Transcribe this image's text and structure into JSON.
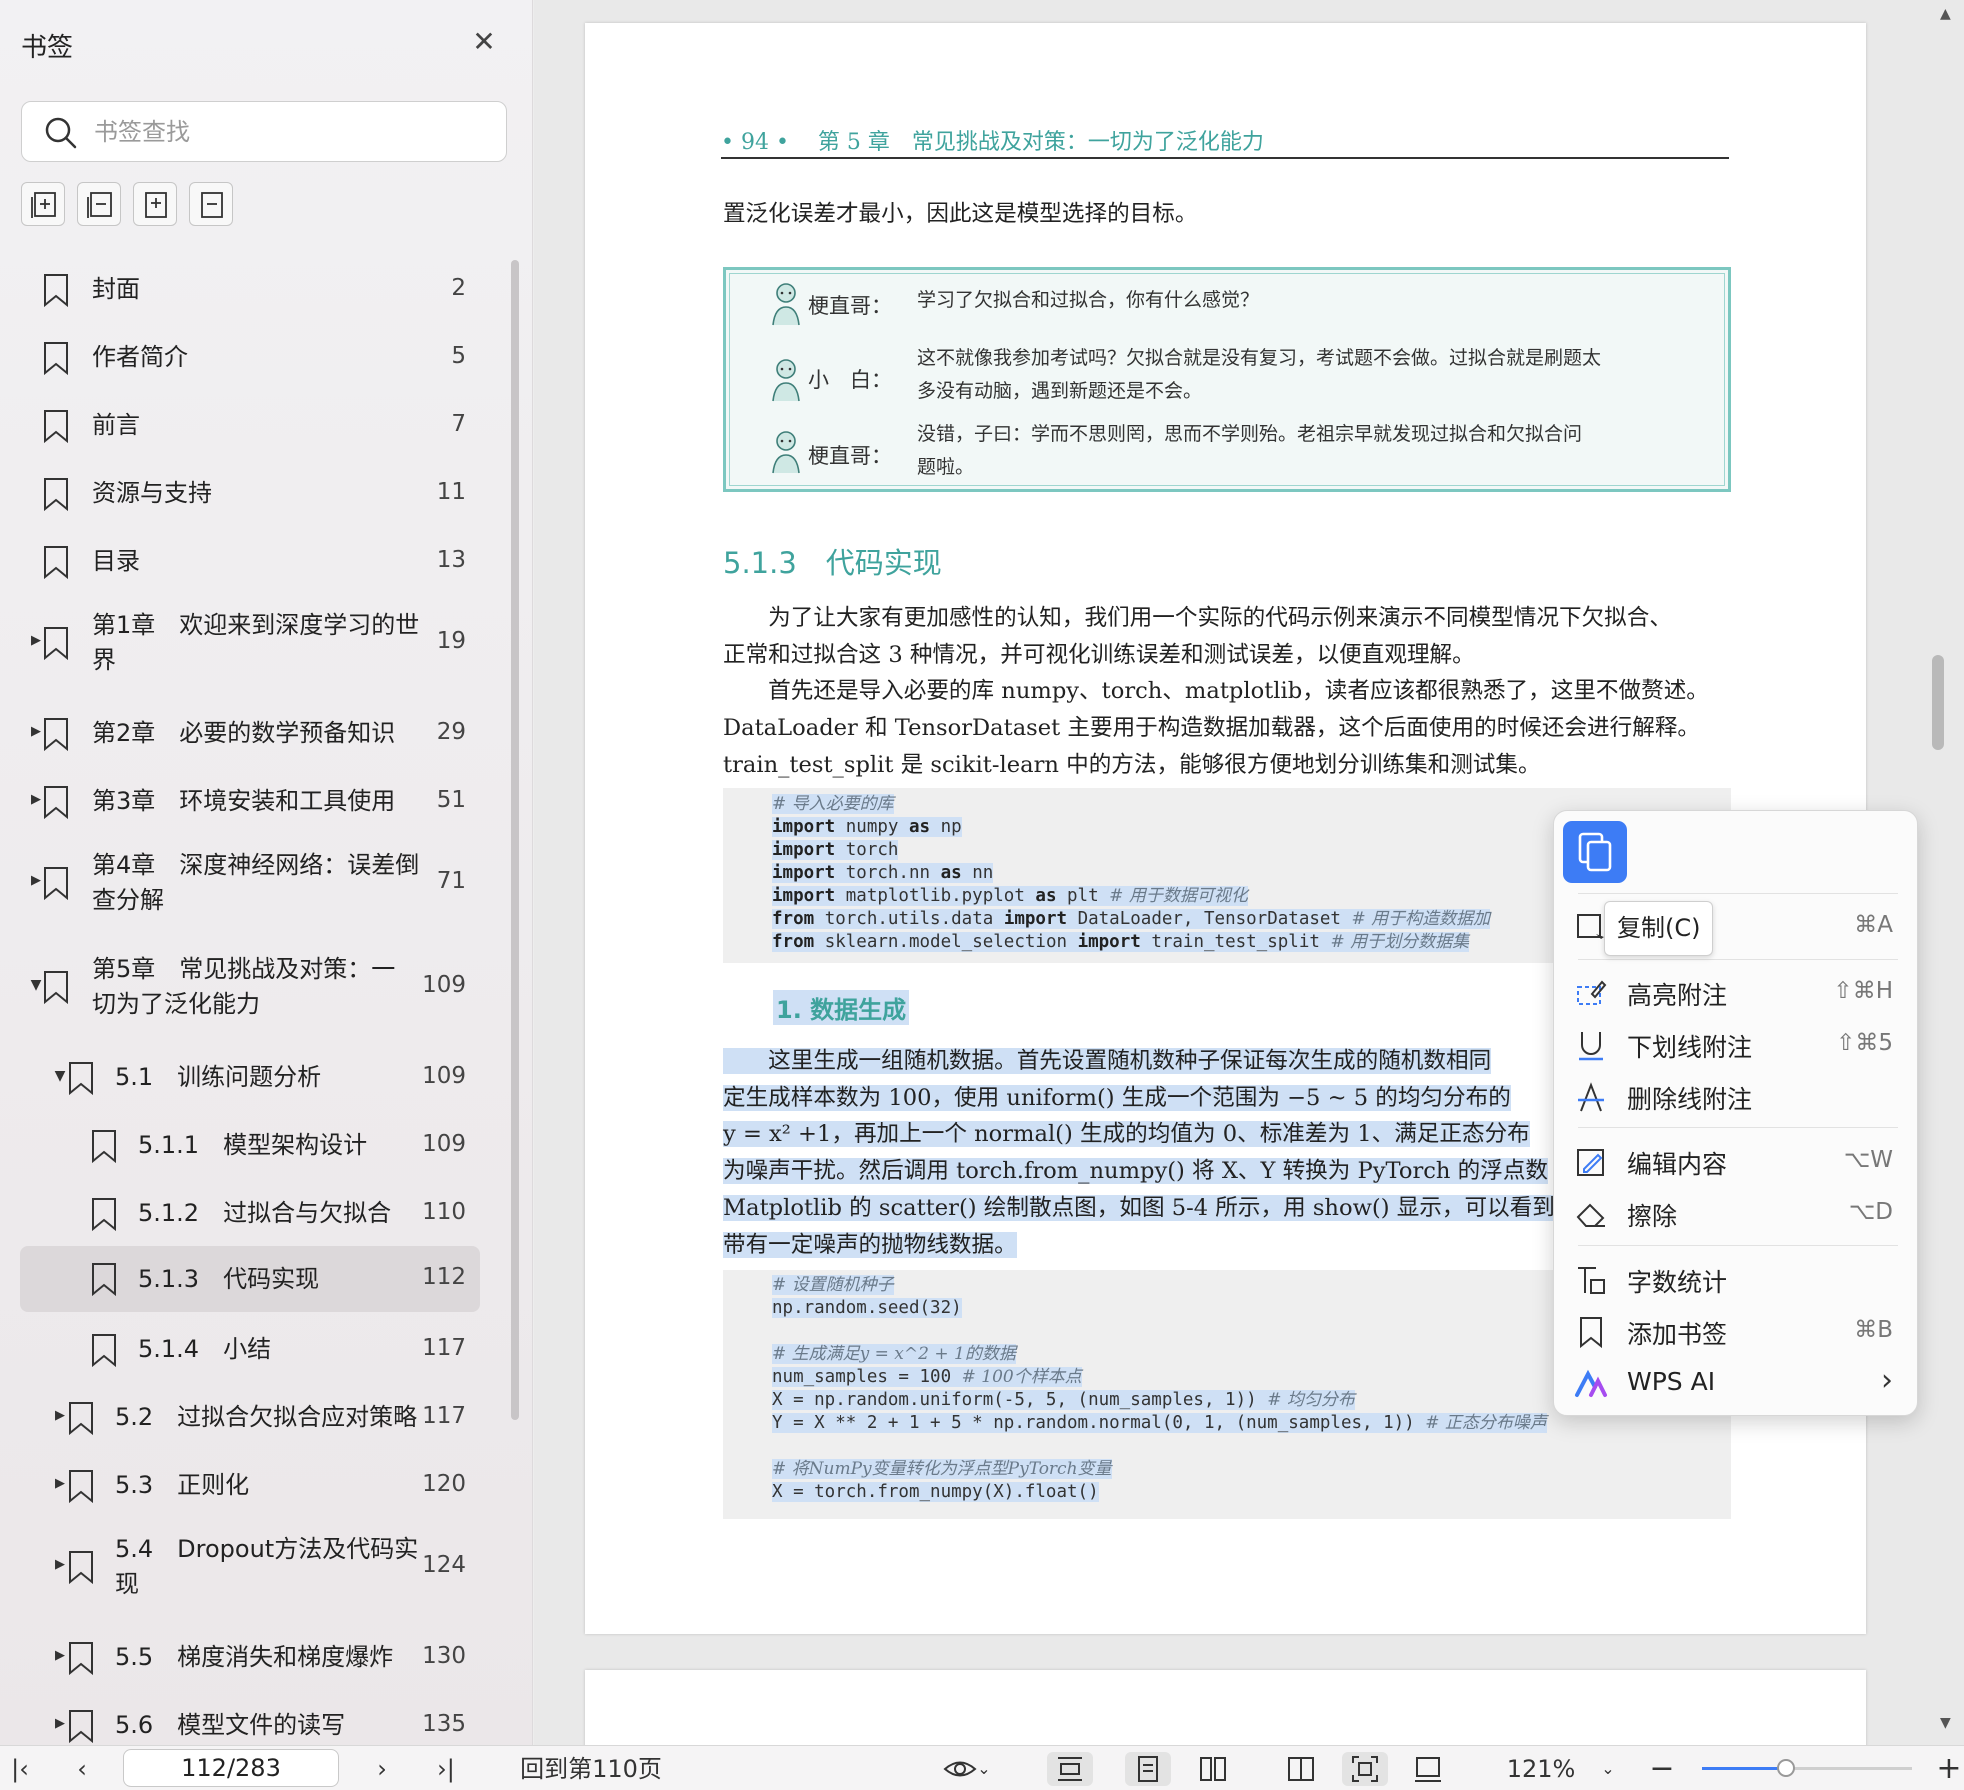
{
  "sidebar": {
    "title": "书签",
    "search_placeholder": "书签查找",
    "items": [
      {
        "label": "封面",
        "page": "2"
      },
      {
        "label": "作者简介",
        "page": "5"
      },
      {
        "label": "前言",
        "page": "7"
      },
      {
        "label": "资源与支持",
        "page": "11"
      },
      {
        "label": "目录",
        "page": "13"
      },
      {
        "label": "第1章　欢迎来到深度学习的世",
        "label2": "界",
        "page": "19"
      },
      {
        "label": "第2章　必要的数学预备知识",
        "page": "29"
      },
      {
        "label": "第3章　环境安装和工具使用",
        "page": "51"
      },
      {
        "label": "第4章　深度神经网络：误差倒",
        "label2": "查分解",
        "page": "71"
      },
      {
        "label": "第5章　常见挑战及对策：一",
        "label2": "切为了泛化能力",
        "page": "109"
      },
      {
        "label": "5.1　训练问题分析",
        "page": "109"
      },
      {
        "label": "5.1.1　模型架构设计",
        "page": "109"
      },
      {
        "label": "5.1.2　过拟合与欠拟合",
        "page": "110"
      },
      {
        "label": "5.1.3　代码实现",
        "page": "112"
      },
      {
        "label": "5.1.4　小结",
        "page": "117"
      },
      {
        "label": "5.2　过拟合欠拟合应对策略",
        "page": "117"
      },
      {
        "label": "5.3　正则化",
        "page": "120"
      },
      {
        "label": "5.4　Dropout方法及代码实",
        "label2": "现",
        "page": "124"
      },
      {
        "label": "5.5　梯度消失和梯度爆炸",
        "page": "130"
      },
      {
        "label": "5.6　模型文件的读写",
        "page": "135"
      }
    ]
  },
  "doc": {
    "running_head": "• 94 •　 第 5 章　常见挑战及对策：一切为了泛化能力",
    "intro": "置泛化误差才最小，因此这是模型选择的目标。",
    "dialog": [
      {
        "speaker": "梗直哥：",
        "lines": [
          "学习了欠拟合和过拟合，你有什么感觉？"
        ]
      },
      {
        "speaker": "小　白：",
        "lines": [
          "这不就像我参加考试吗？欠拟合就是没有复习，考试题不会做。过拟合就是刷题太",
          "多没有动脑，遇到新题还是不会。"
        ]
      },
      {
        "speaker": "梗直哥：",
        "lines": [
          "没错，子曰：学而不思则罔，思而不学则殆。老祖宗早就发现过拟合和欠拟合问",
          "题啦。"
        ]
      }
    ],
    "section_title": "5.1.3　代码实现",
    "paragraph1": [
      "　　为了让大家有更加感性的认知，我们用一个实际的代码示例来演示不同模型情况下欠拟合、",
      "正常和过拟合这 3 种情况，并可视化训练误差和测试误差，以便直观理解。",
      "　　首先还是导入必要的库 numpy、torch、matplotlib，读者应该都很熟悉了，这里不做赘述。",
      "DataLoader 和 TensorDataset 主要用于构造数据加载器，这个后面使用的时候还会进行解释。",
      "train_test_split 是 scikit-learn 中的方法，能够很方便地划分训练集和测试集。"
    ],
    "code1": [
      {
        "cm": "# 导入必要的库"
      },
      {
        "kw": "import",
        "t": " numpy ",
        "kw2": "as",
        "t2": " np"
      },
      {
        "kw": "import",
        "t": " torch"
      },
      {
        "kw": "import",
        "t": " torch.nn ",
        "kw2": "as",
        "t2": " nn"
      },
      {
        "kw": "import",
        "t": " matplotlib.pyplot ",
        "kw2": "as",
        "t2": " plt ",
        "cm": "# 用于数据可视化"
      },
      {
        "kw": "from",
        "t": " torch.utils.data ",
        "kw2": "import",
        "t2": " DataLoader, TensorDataset ",
        "cm": "# 用于构造数据加"
      },
      {
        "kw": "from",
        "t": " sklearn.model_selection ",
        "kw2": "import",
        "t2": " train_test_split ",
        "cm": "# 用于划分数据集"
      }
    ],
    "sub_title": "1. 数据生成",
    "paragraph2": [
      "　　这里生成一组随机数据。首先设置随机数种子保证每次生成的随机数相同",
      "定生成样本数为 100，使用 uniform() 生成一个范围为 −5 ~ 5 的均匀分布的",
      "y = x² +1，再加上一个 normal() 生成的均值为 0、标准差为 1、满足正态分布",
      "为噪声干扰。然后调用 torch.from_numpy() 将 X、Y 转换为 PyTorch 的浮点数",
      "Matplotlib 的 scatter() 绘制散点图，如图 5-4 所示，用 show() 显示，可以看到生",
      "带有一定噪声的抛物线数据。"
    ],
    "code2": [
      {
        "cm": "# 设置随机种子"
      },
      {
        "t": "np.random.seed(32)"
      },
      {
        "t": ""
      },
      {
        "cm": "# 生成满足y = x^2 + 1的数据"
      },
      {
        "t": "num_samples = 100 ",
        "cm": "# 100个样本点"
      },
      {
        "t": "X = np.random.uniform(-5, 5, (num_samples, 1)) ",
        "cm": "# 均匀分布"
      },
      {
        "t": "Y = X ** 2 + 1 + 5 * np.random.normal(0, 1, (num_samples, 1)) ",
        "cm": "# 正态分布噪声"
      },
      {
        "t": ""
      },
      {
        "cm": "# 将NumPy变量转化为浮点型PyTorch变量"
      },
      {
        "t": "X = torch.from_numpy(X).float()"
      }
    ]
  },
  "context_menu": {
    "tooltip": "复制(C)",
    "items": [
      {
        "label": "",
        "key": "⌘A"
      },
      {
        "label": "高亮附注",
        "key": "⇧⌘H"
      },
      {
        "label": "下划线附注",
        "key": "⇧⌘5"
      },
      {
        "label": "删除线附注",
        "key": ""
      },
      {
        "label": "编辑内容",
        "key": "⌥W"
      },
      {
        "label": "擦除",
        "key": "⌥D"
      },
      {
        "label": "字数统计",
        "key": ""
      },
      {
        "label": "添加书签",
        "key": "⌘B"
      },
      {
        "label": "WPS AI",
        "key": "›"
      }
    ]
  },
  "bottombar": {
    "page_indicator": "112/283",
    "back_to_page": "回到第110页",
    "zoom": "121%",
    "zoom_fraction": 0.4
  },
  "colors": {
    "accent": "#3d7cf5",
    "teal": "#3fa39d",
    "selection": "#cfe0f5"
  }
}
